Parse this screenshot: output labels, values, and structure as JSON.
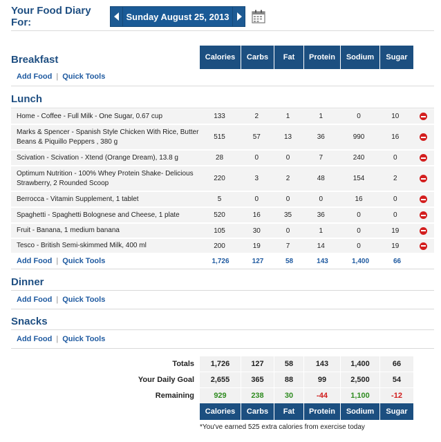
{
  "header": {
    "title": "Your Food Diary For:",
    "date": "Sunday August 25, 2013"
  },
  "columns": [
    "Calories",
    "Carbs",
    "Fat",
    "Protein",
    "Sodium",
    "Sugar"
  ],
  "meals": {
    "breakfast": {
      "title": "Breakfast",
      "add_food": "Add Food",
      "quick_tools": "Quick Tools"
    },
    "lunch": {
      "title": "Lunch",
      "add_food": "Add Food",
      "quick_tools": "Quick Tools",
      "foods": [
        {
          "name": "Home - Coffee - Full Milk - One Sugar, 0.67 cup",
          "values": [
            "133",
            "2",
            "1",
            "1",
            "0",
            "10"
          ]
        },
        {
          "name": "Marks & Spencer - Spanish Style Chicken With Rice, Butter Beans & Piquillo Peppers , 380 g",
          "values": [
            "515",
            "57",
            "13",
            "36",
            "990",
            "16"
          ]
        },
        {
          "name": "Scivation - Scivation - Xtend (Orange Dream), 13.8 g",
          "values": [
            "28",
            "0",
            "0",
            "7",
            "240",
            "0"
          ]
        },
        {
          "name": "Optimum Nutrition - 100% Whey Protein Shake- Delicious Strawberry, 2 Rounded Scoop",
          "values": [
            "220",
            "3",
            "2",
            "48",
            "154",
            "2"
          ]
        },
        {
          "name": "Berrocca - Vitamin Supplement, 1 tablet",
          "values": [
            "5",
            "0",
            "0",
            "0",
            "16",
            "0"
          ]
        },
        {
          "name": "Spaghetti - Spaghetti Bolognese and Cheese, 1 plate",
          "values": [
            "520",
            "16",
            "35",
            "36",
            "0",
            "0"
          ]
        },
        {
          "name": "Fruit - Banana, 1 medium banana",
          "values": [
            "105",
            "30",
            "0",
            "1",
            "0",
            "19"
          ]
        },
        {
          "name": "Tesco - British Semi-skimmed Milk, 400 ml",
          "values": [
            "200",
            "19",
            "7",
            "14",
            "0",
            "19"
          ]
        }
      ],
      "totals": [
        "1,726",
        "127",
        "58",
        "143",
        "1,400",
        "66"
      ]
    },
    "dinner": {
      "title": "Dinner",
      "add_food": "Add Food",
      "quick_tools": "Quick Tools"
    },
    "snacks": {
      "title": "Snacks",
      "add_food": "Add Food",
      "quick_tools": "Quick Tools"
    }
  },
  "summary": {
    "totals_label": "Totals",
    "totals": [
      "1,726",
      "127",
      "58",
      "143",
      "1,400",
      "66"
    ],
    "goal_label": "Your Daily Goal",
    "goal": [
      "2,655",
      "365",
      "88",
      "99",
      "2,500",
      "54"
    ],
    "remaining_label": "Remaining",
    "remaining": [
      "929",
      "238",
      "30",
      "-44",
      "1,100",
      "-12"
    ],
    "remaining_status": [
      "positive",
      "positive",
      "positive",
      "negative",
      "positive",
      "negative"
    ]
  },
  "footer_note": "*You've earned 525 extra calories from exercise today",
  "colors": {
    "brand": "#1c4f80",
    "link": "#1f5aa0",
    "positive": "#2e8b1f",
    "negative": "#d01a1a"
  }
}
